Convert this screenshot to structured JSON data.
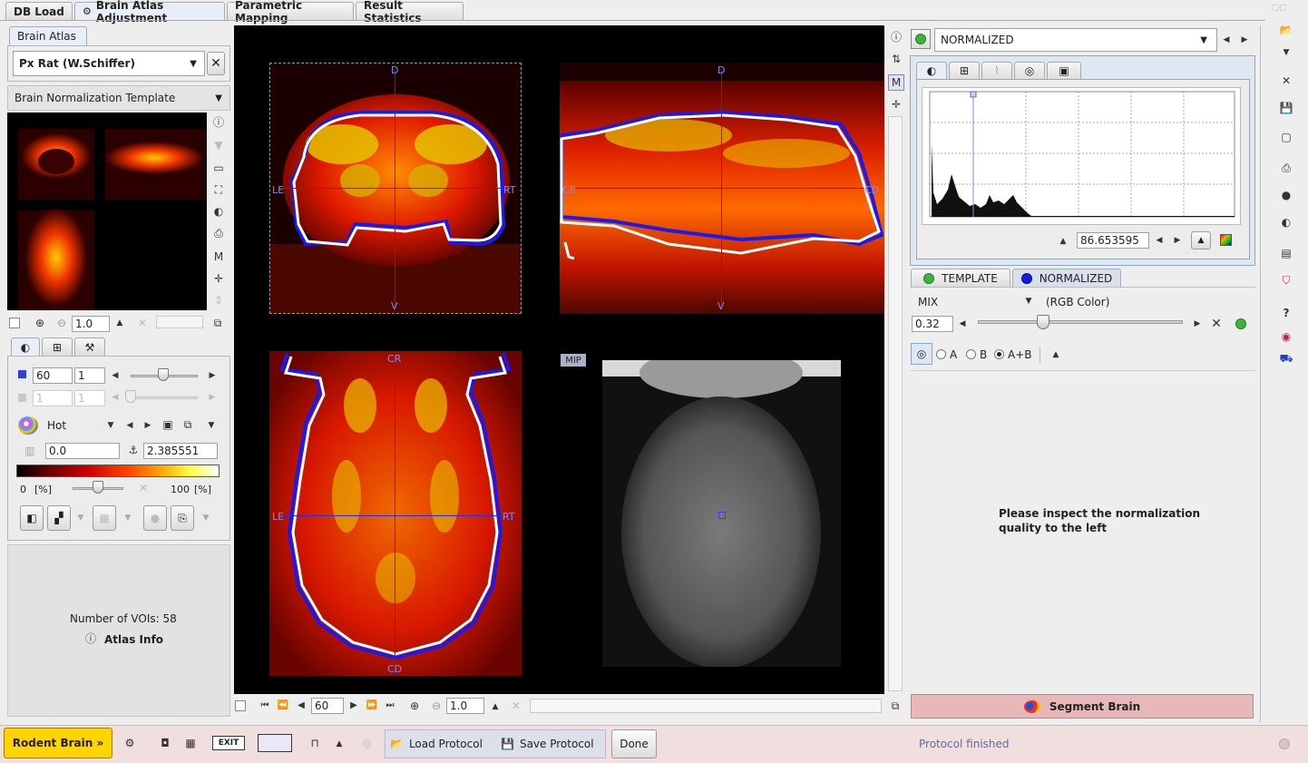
{
  "tabs": [
    {
      "label": "DB Load"
    },
    {
      "label": "Brain Atlas Adjustment"
    },
    {
      "label": "Parametric Mapping"
    },
    {
      "label": "Result Statistics"
    }
  ],
  "left": {
    "subtab": "Brain Atlas",
    "atlas_select": "Px Rat (W.Schiffer)",
    "template_select": "Brain Normalization Template",
    "zoom_value": "1.0",
    "frame_value": "60",
    "frame_step": "1",
    "frame2_value": "1",
    "frame2_step": "1",
    "colormap": "Hot",
    "min_value": "0.0",
    "max_value": "2.385551",
    "pct_min": "0",
    "pct_unit": "[%]",
    "pct_max": "100",
    "pct_unit2": "[%]",
    "voi_count": "Number of VOIs: 58",
    "atlas_info": "Atlas Info"
  },
  "viewer": {
    "views": [
      {
        "name": "coronal",
        "top": "D",
        "bottom": "V",
        "left": "LE",
        "right": "RT"
      },
      {
        "name": "sagittal",
        "top": "D",
        "bottom": "V",
        "left": "CR",
        "right": "CD"
      },
      {
        "name": "axial",
        "top": "CR",
        "bottom": "CD",
        "left": "LE",
        "right": "RT"
      }
    ],
    "mip_label": "MIP",
    "frame_value": "60",
    "zoom_value": "1.0"
  },
  "right": {
    "series_select": "NORMALIZED",
    "histogram_value": "86.653595",
    "template_tab": "TEMPLATE",
    "normalized_tab": "NORMALIZED",
    "fusion_mode": "MIX",
    "color_mode": "(RGB Color)",
    "mix_value": "0.32",
    "mix_fraction": 0.32,
    "radio_a": "A",
    "radio_b": "B",
    "radio_ab": "A+B",
    "message_line1": "Please inspect the normalization",
    "message_line2": "quality to the left",
    "segment_button": "Segment Brain"
  },
  "bottom": {
    "rodent_button": "Rodent Brain »",
    "load_protocol": "Load Protocol",
    "save_protocol": "Save Protocol",
    "done": "Done",
    "status": "Protocol finished"
  },
  "colors": {
    "accent_yellow": "#ffd400",
    "status_bg": "#f1dede",
    "segment_bg": "#e8b8b8",
    "contour_blue": "#1a1aee",
    "cross_blue": "#2a2ad8"
  }
}
